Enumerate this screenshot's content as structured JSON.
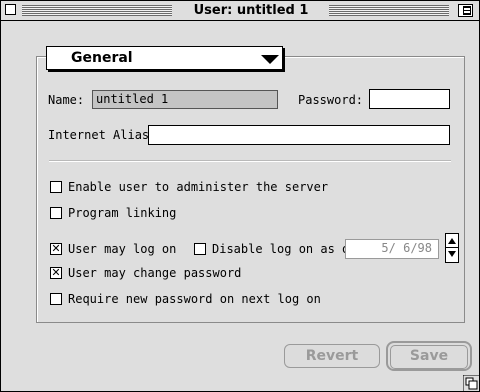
{
  "window": {
    "title": "User: untitled 1"
  },
  "popup": {
    "selected": "General"
  },
  "form": {
    "name_label": "Name:",
    "name_value": "untitled 1",
    "password_label": "Password:",
    "password_value": "",
    "alias_label": "Internet Alias:",
    "alias_value": "",
    "admin_label": "Enable user to administer the server",
    "admin_checked": false,
    "program_linking_label": "Program linking",
    "program_linking_checked": false,
    "logon_label": "User may log on",
    "logon_checked": true,
    "disable_logon_label": "Disable log on as of:",
    "disable_logon_checked": false,
    "disable_date": "5/ 6/98",
    "change_pw_label": "User may change password",
    "change_pw_checked": true,
    "require_new_pw_label": "Require new password on next log on",
    "require_new_pw_checked": false
  },
  "buttons": {
    "revert": "Revert",
    "save": "Save"
  },
  "glyphs": {
    "checked": "✕"
  }
}
